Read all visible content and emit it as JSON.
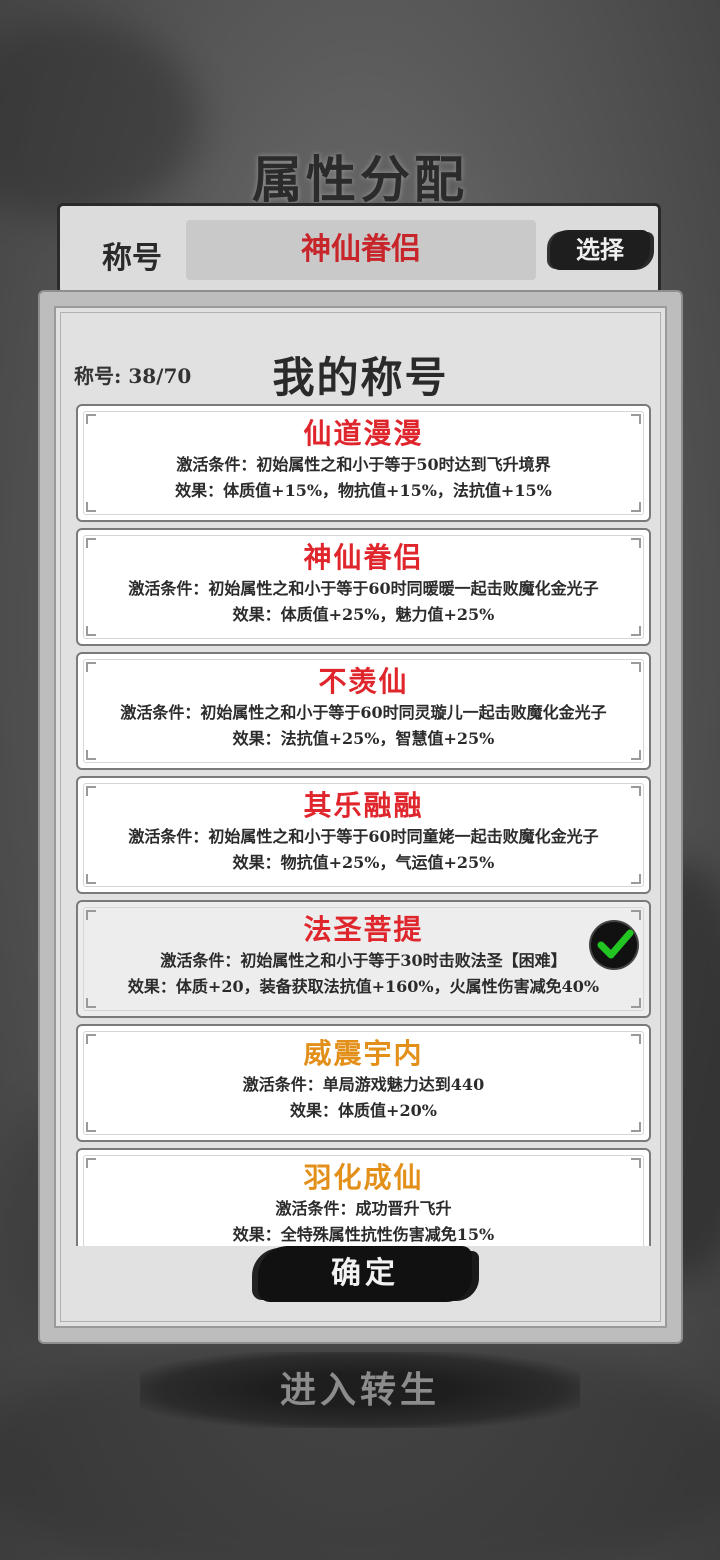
{
  "page_title": "属性分配",
  "title_bar": {
    "label": "称号",
    "current_title": "神仙眷侣",
    "select_label": "选择"
  },
  "modal": {
    "title": "我的称号",
    "progress": "称号: 38/70",
    "confirm_label": "确定"
  },
  "titles": [
    {
      "name": "仙道漫漫",
      "color": "#e0262d",
      "condition": "激活条件：初始属性之和小于等于50时达到飞升境界",
      "effect": "效果：体质值+15%，物抗值+15%，法抗值+15%",
      "equipped": false
    },
    {
      "name": "神仙眷侣",
      "color": "#e0262d",
      "condition": "激活条件：初始属性之和小于等于60时同暖暖一起击败魔化金光子",
      "effect": "效果：体质值+25%，魅力值+25%",
      "equipped": false
    },
    {
      "name": "不羡仙",
      "color": "#e0262d",
      "condition": "激活条件：初始属性之和小于等于60时同灵璇儿一起击败魔化金光子",
      "effect": "效果：法抗值+25%，智慧值+25%",
      "equipped": false
    },
    {
      "name": "其乐融融",
      "color": "#e0262d",
      "condition": "激活条件：初始属性之和小于等于60时同童姥一起击败魔化金光子",
      "effect": "效果：物抗值+25%，气运值+25%",
      "equipped": false
    },
    {
      "name": "法圣菩提",
      "color": "#e0262d",
      "condition": "激活条件：初始属性之和小于等于30时击败法圣【困难】",
      "effect": "效果：体质+20，装备获取法抗值+160%，火属性伤害减免40%",
      "equipped": true
    },
    {
      "name": "威震宇内",
      "color": "#e3901a",
      "condition": "激活条件：单局游戏魅力达到440",
      "effect": "效果：体质值+20%",
      "equipped": false
    },
    {
      "name": "羽化成仙",
      "color": "#e3901a",
      "condition": "激活条件：成功晋升飞升",
      "effect": "效果：全特殊属性抗性伤害减免15%",
      "equipped": false
    }
  ],
  "reincarnate_label": "进入转生",
  "icons": {
    "equipped": "check-icon"
  }
}
